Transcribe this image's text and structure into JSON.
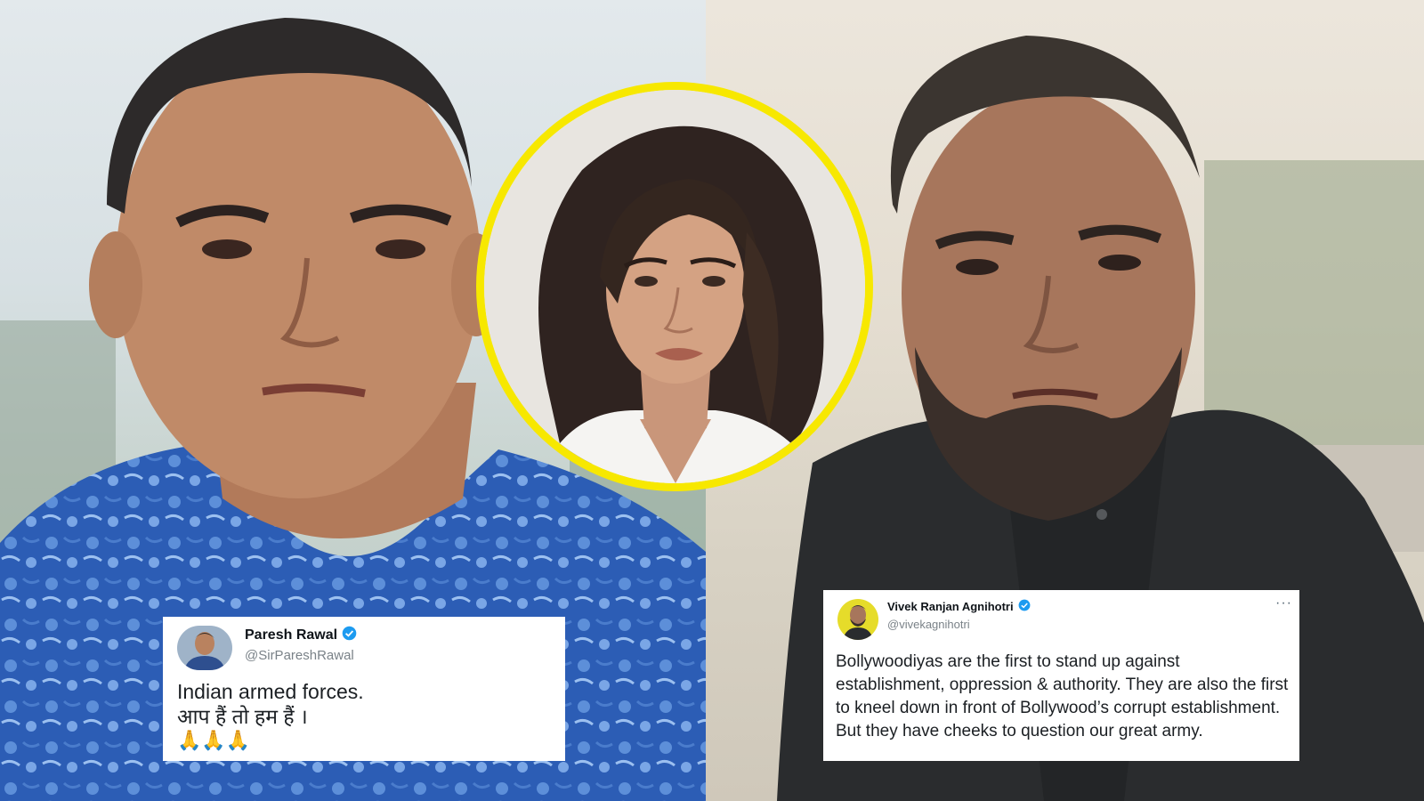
{
  "tweets": {
    "left": {
      "name": "Paresh Rawal",
      "handle": "@SirPareshRawal",
      "line1": "Indian armed forces.",
      "line2": "आप हैं तो हम हैं ।",
      "emoji": "🙏🙏🙏",
      "verified_color": "#1d9bf0"
    },
    "right": {
      "name": "Vivek Ranjan Agnihotri",
      "handle": "@vivekagnihotri",
      "more": "···",
      "text": "Bollywoodiyas are the first to stand up against establishment, oppression & authority. They are also the first to kneel down in front of Bollywood’s corrupt establishment. But they have cheeks to question our great army.",
      "verified_color": "#1d9bf0"
    }
  },
  "colors": {
    "inset_border": "#f7e800",
    "shirt_left": "#2f5fb8",
    "shirt_right": "#2a2c2e"
  }
}
